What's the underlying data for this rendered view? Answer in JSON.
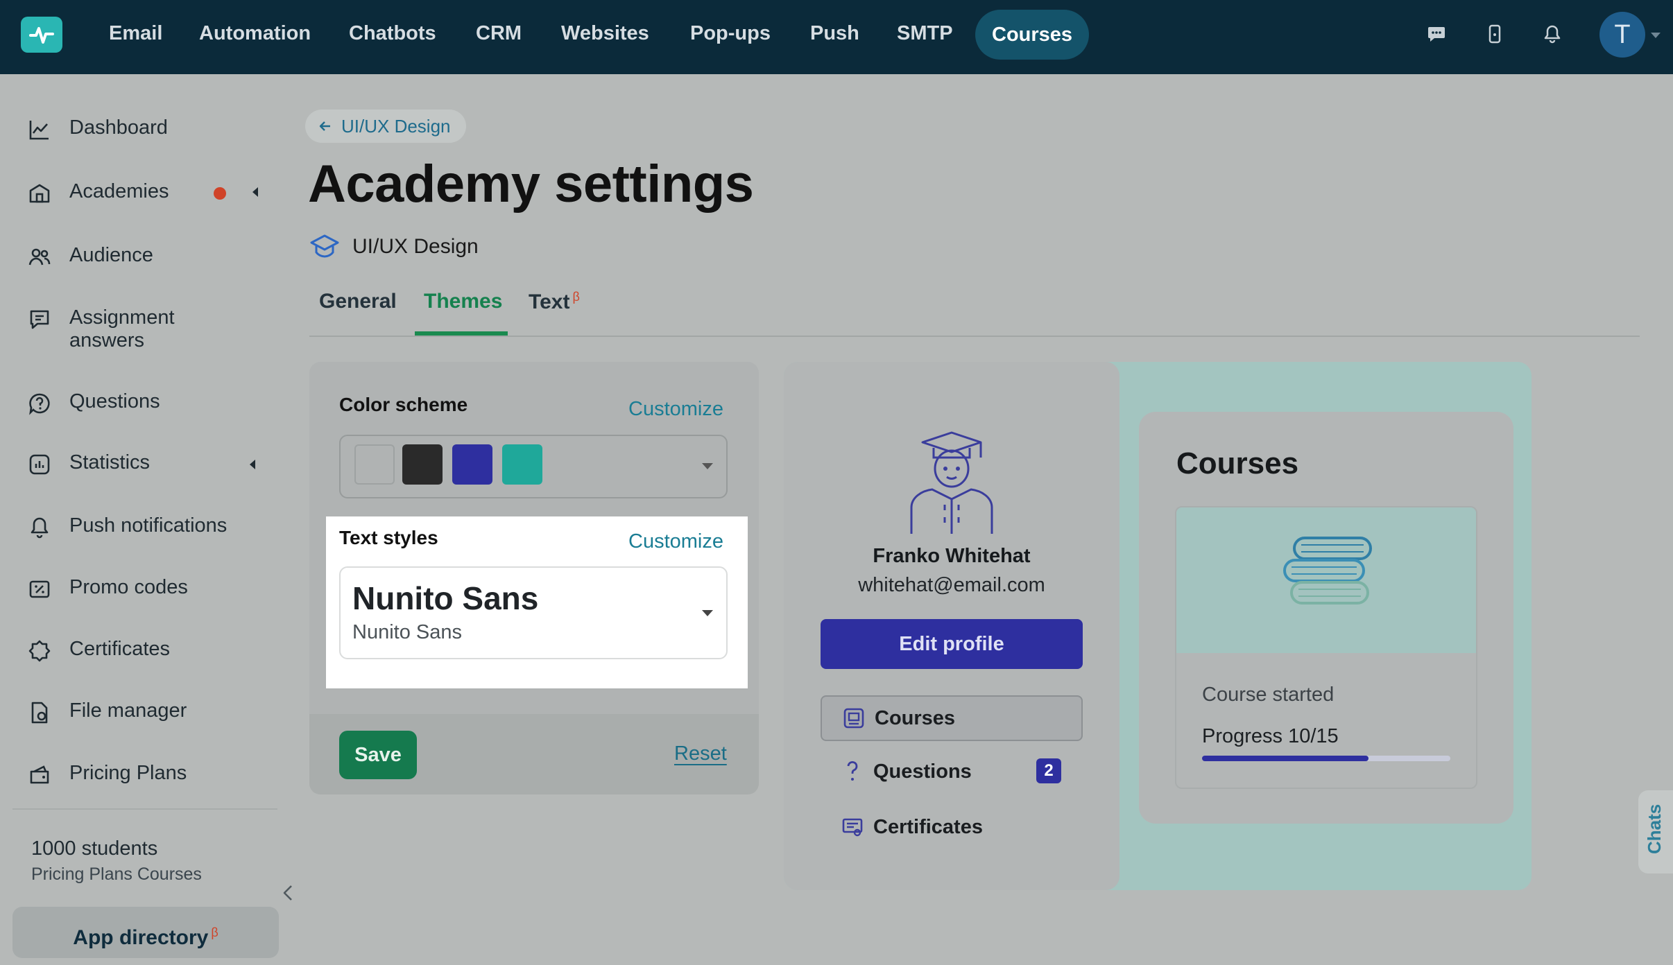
{
  "nav": {
    "items": [
      "Email",
      "Automation",
      "Chatbots",
      "CRM",
      "Websites",
      "Pop-ups",
      "Push",
      "SMTP",
      "Courses"
    ],
    "active": "Courses",
    "avatar_letter": "T"
  },
  "sidebar": {
    "items": [
      {
        "label": "Dashboard",
        "icon": "chart-line-icon"
      },
      {
        "label": "Academies",
        "icon": "academy-icon"
      },
      {
        "label": "Audience",
        "icon": "users-icon"
      },
      {
        "label": "Assignment answers",
        "icon": "assignment-icon"
      },
      {
        "label": "Questions",
        "icon": "question-icon"
      },
      {
        "label": "Statistics",
        "icon": "statistics-icon"
      },
      {
        "label": "Push notifications",
        "icon": "bell-icon"
      },
      {
        "label": "Promo codes",
        "icon": "promo-icon"
      },
      {
        "label": "Certificates",
        "icon": "certificate-icon"
      },
      {
        "label": "File manager",
        "icon": "file-icon"
      },
      {
        "label": "Pricing Plans",
        "icon": "pricing-icon"
      }
    ],
    "students": "1000 students",
    "students_sub": "Pricing Plans Courses",
    "app_directory": "App directory",
    "beta_mark": "β"
  },
  "main": {
    "breadcrumb": "UI/UX Design",
    "title": "Academy settings",
    "academy_name": "UI/UX Design",
    "tabs": [
      {
        "label": "General"
      },
      {
        "label": "Themes"
      },
      {
        "label": "Text",
        "beta": "β"
      }
    ],
    "active_tab": "Themes"
  },
  "settings": {
    "color_scheme_label": "Color scheme",
    "customize": "Customize",
    "swatches": [
      "#b3b6b6",
      "#2a2a2a",
      "#2e2f9f",
      "#1fa89a"
    ],
    "text_styles_label": "Text styles",
    "font_title": "Nunito Sans",
    "font_sub": "Nunito Sans",
    "save": "Save",
    "reset": "Reset"
  },
  "preview": {
    "name": "Franko Whitehat",
    "email": "whitehat@email.com",
    "edit_profile": "Edit profile",
    "menu": [
      {
        "label": "Courses",
        "icon": "courses-icon"
      },
      {
        "label": "Questions",
        "icon": "question-mark-icon",
        "badge": "2"
      },
      {
        "label": "Certificates",
        "icon": "certificate-icon"
      }
    ],
    "courses_title": "Courses",
    "course_status": "Course started",
    "progress_label": "Progress 10/15",
    "progress_fraction": 0.67
  },
  "chats": "Chats"
}
